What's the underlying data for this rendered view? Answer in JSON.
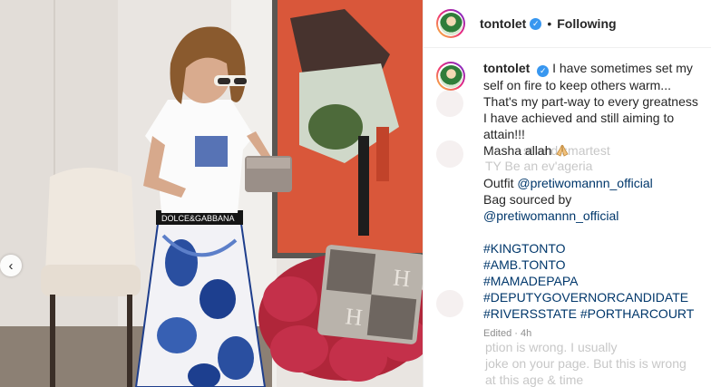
{
  "post": {
    "username": "tontolet",
    "follow_state": "Following",
    "separator": "•"
  },
  "caption": {
    "username": "tontolet",
    "text_lines": [
      "I have sometimes set my",
      "self on fire to keep others warm...",
      "That's my part-way to every greatness",
      "I have achieved and still aiming to",
      "attain!!!"
    ],
    "masha": "Masha allah",
    "outfit_label": "Outfit",
    "outfit_mention": "@pretiwomannn_official",
    "bag_label": "Bag sourced by",
    "bag_mention": "@pretiwomannn_official",
    "hashtags": [
      "#KINGTONTO",
      "#AMB.TONTO",
      "#MAMADEPAPA",
      "#DEPUTYGOVERNORCANDIDATE",
      "#RIVERSSTATE",
      "#PORTHARCOURT"
    ],
    "edited": "Edited",
    "time": "4h"
  },
  "ghost_comments": [
    "st and smartest",
    "TY Be an ev'ageria",
    "ption is wrong. I usually",
    "joke on your page. But this is wrong",
    "at this age & time"
  ],
  "photo": {
    "waistband_text": "DOLCE&GABBANA",
    "pillow_letter": "H"
  },
  "icons": {
    "verified": "verified-badge-icon",
    "prev": "chevron-left-icon",
    "emoji": "praying-hands-emoji"
  },
  "colors": {
    "link": "#00376b",
    "verified": "#3897f0",
    "text": "#262626",
    "muted": "#8e8e8e"
  }
}
